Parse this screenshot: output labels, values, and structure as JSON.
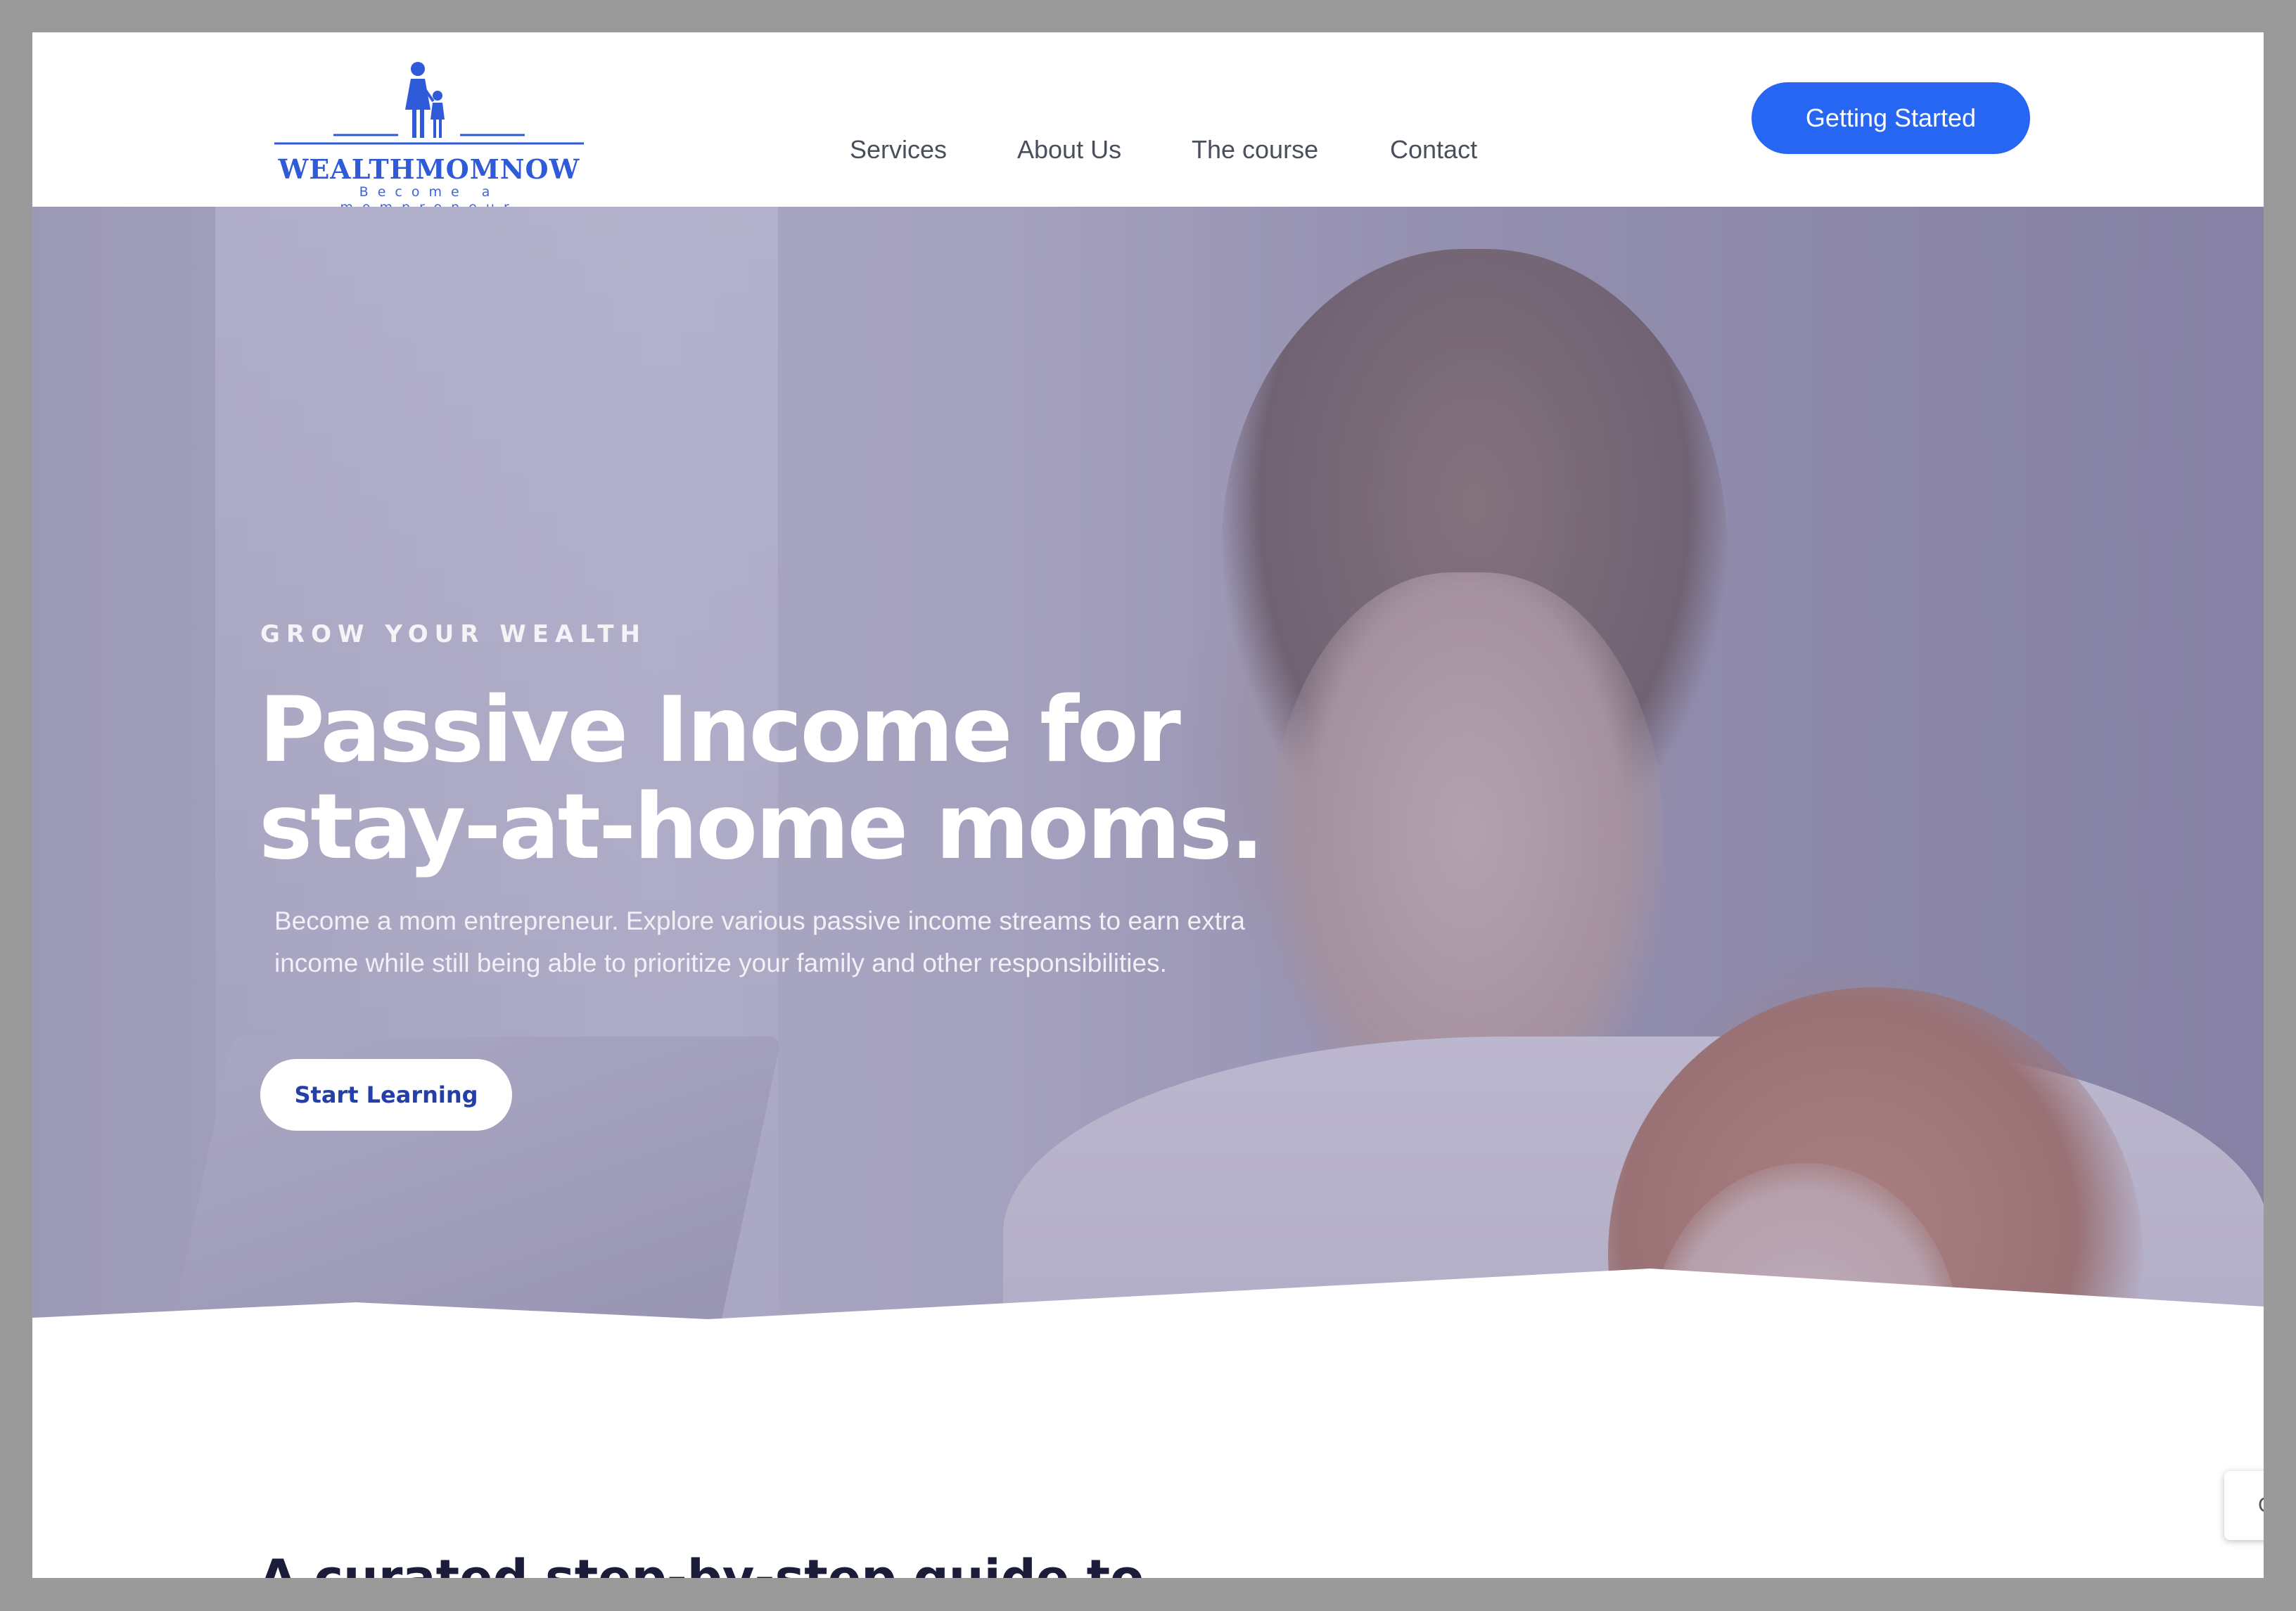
{
  "header": {
    "logo": {
      "wordmark": "WEALTHMOMNOW",
      "tagline": "Become a mompreneur",
      "brand_color": "#2f5ad8"
    },
    "nav": [
      "Services",
      "About Us",
      "The course",
      "Contact"
    ],
    "cta_label": "Getting Started",
    "cta_color": "#2766f3"
  },
  "hero": {
    "eyebrow": "GROW YOUR WEALTH",
    "headline_line1": "Passive Income for",
    "headline_line2": "stay-at-home moms.",
    "subtext_line1": "Become a mom entrepreneur. Explore various passive income streams to earn extra",
    "subtext_line2": "income while still being able to prioritize your family and other responsibilities.",
    "button_label": "Start Learning",
    "button_text_color": "#2440a8"
  },
  "section": {
    "title": "A curated step-by-step guide to"
  },
  "widget": {
    "label": "C"
  }
}
